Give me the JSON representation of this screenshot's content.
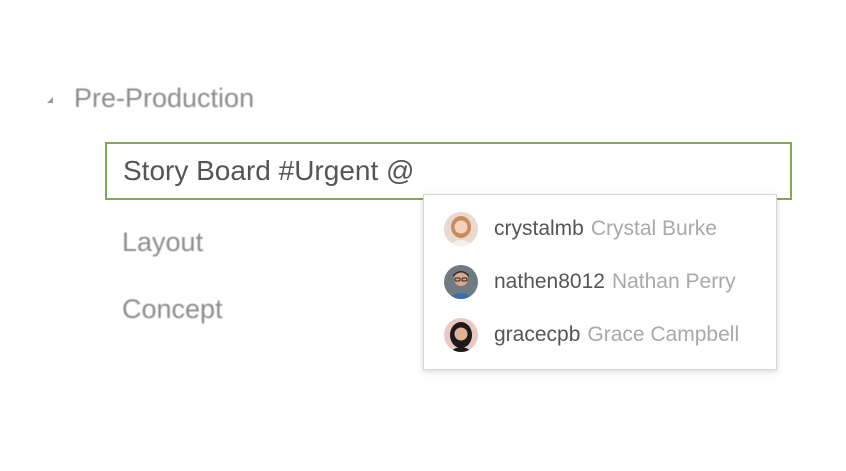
{
  "section": {
    "title": "Pre-Production",
    "toggle_icon": "triangle-collapse-icon"
  },
  "task_input": {
    "value": "Story Board #Urgent @"
  },
  "tasks": [
    {
      "label": "Layout"
    },
    {
      "label": "Concept"
    }
  ],
  "mention_suggestions": [
    {
      "username": "crystalmb",
      "full_name": "Crystal Burke",
      "avatar": "avatar-crystal-icon"
    },
    {
      "username": "nathen8012",
      "full_name": "Nathan Perry",
      "avatar": "avatar-nathan-icon"
    },
    {
      "username": "gracecpb",
      "full_name": "Grace Campbell",
      "avatar": "avatar-grace-icon"
    }
  ],
  "colors": {
    "input_border": "#7dab55",
    "primary_text": "#555555",
    "muted_text": "#a9a9a9"
  }
}
